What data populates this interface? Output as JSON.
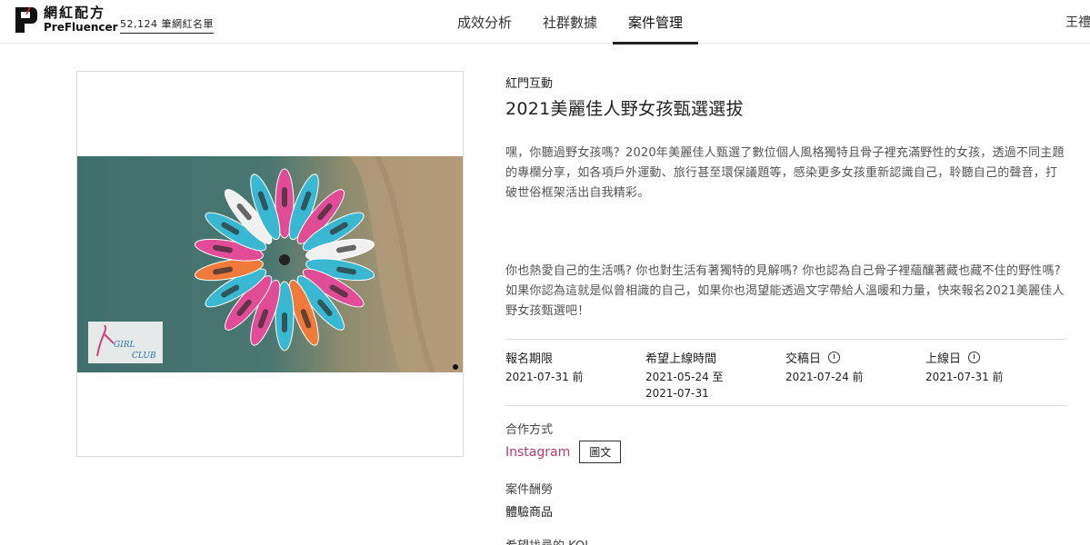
{
  "header": {
    "logo_zh": "網紅配方",
    "logo_en": "PreFluencer",
    "influencer_count": "52,124 筆網紅名單",
    "nav": [
      {
        "label": "成效分析",
        "active": false
      },
      {
        "label": "社群數據",
        "active": false
      },
      {
        "label": "案件管理",
        "active": true
      }
    ],
    "user": "王禮"
  },
  "campaign": {
    "brand": "紅門互動",
    "title": "2021美麗佳人野女孩甄選選拔",
    "intro": "嘿，你聽過野女孩嗎？2020年美麗佳人甄選了數位個人風格獨特且骨子裡充滿野性的女孩，透過不同主題的專欄分享，如各項戶外運動、旅行甚至環保議題等，感染更多女孩重新認識自己，聆聽自己的聲音，打破世俗框架活出自我精彩。",
    "description": "你也熱愛自己的生活嗎? 你也對生活有著獨特的見解嗎? 你也認為自己骨子裡蘊釀著藏也藏不住的野性嗎? 如果你認為這就是似曾相識的自己，如果你也渴望能透過文字帶給人溫暖和力量，快來報名2021美麗佳人野女孩甄選吧！",
    "meta": [
      {
        "label": "報名期限",
        "value": "2021-07-31 前",
        "info": false
      },
      {
        "label": "希望上線時間",
        "value": "2021-05-24 至\n2021-07-31",
        "info": false
      },
      {
        "label": "交稿日",
        "value": "2021-07-24 前",
        "info": true
      },
      {
        "label": "上線日",
        "value": "2021-07-31 前",
        "info": true
      }
    ],
    "cooperation_label": "合作方式",
    "platform": "Instagram",
    "format_tag": "圖文",
    "reward_label": "案件酬勞",
    "reward_value": "體驗商品",
    "kol_label": "希望找尋的 KOL"
  },
  "photo": {
    "watermark_text": "GIRL CLUB",
    "colors": {
      "water": "#3f6f6d",
      "sand": "#b7a07c",
      "pink": "#e04c95",
      "cyan": "#3ab8d2",
      "orange": "#ef7a3c",
      "white": "#f1f1f1"
    }
  },
  "colors": {
    "instagram": "#b03a6a",
    "accent": "#222222"
  }
}
